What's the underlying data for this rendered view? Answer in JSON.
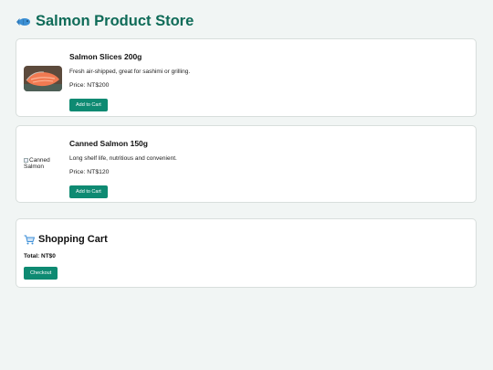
{
  "header": {
    "title": "Salmon Product Store",
    "icon": "fish-icon"
  },
  "products": [
    {
      "name": "Salmon Slices 200g",
      "description": "Fresh air-shipped, great for sashimi or grilling.",
      "price": "Price: NT$200",
      "button_label": "Add to Cart",
      "image": "salmon-slice-photo"
    },
    {
      "name": "Canned Salmon 150g",
      "description": "Long shelf life, nutritious and convenient.",
      "price": "Price: NT$120",
      "button_label": "Add to Cart",
      "image_alt": "Canned Salmon"
    }
  ],
  "cart": {
    "title": "Shopping Cart",
    "icon": "shopping-cart-icon",
    "total": "Total: NT$0",
    "checkout_label": "Checkout"
  },
  "colors": {
    "accent": "#0e8a72",
    "title": "#0f6b58",
    "background": "#f1f5f4"
  }
}
